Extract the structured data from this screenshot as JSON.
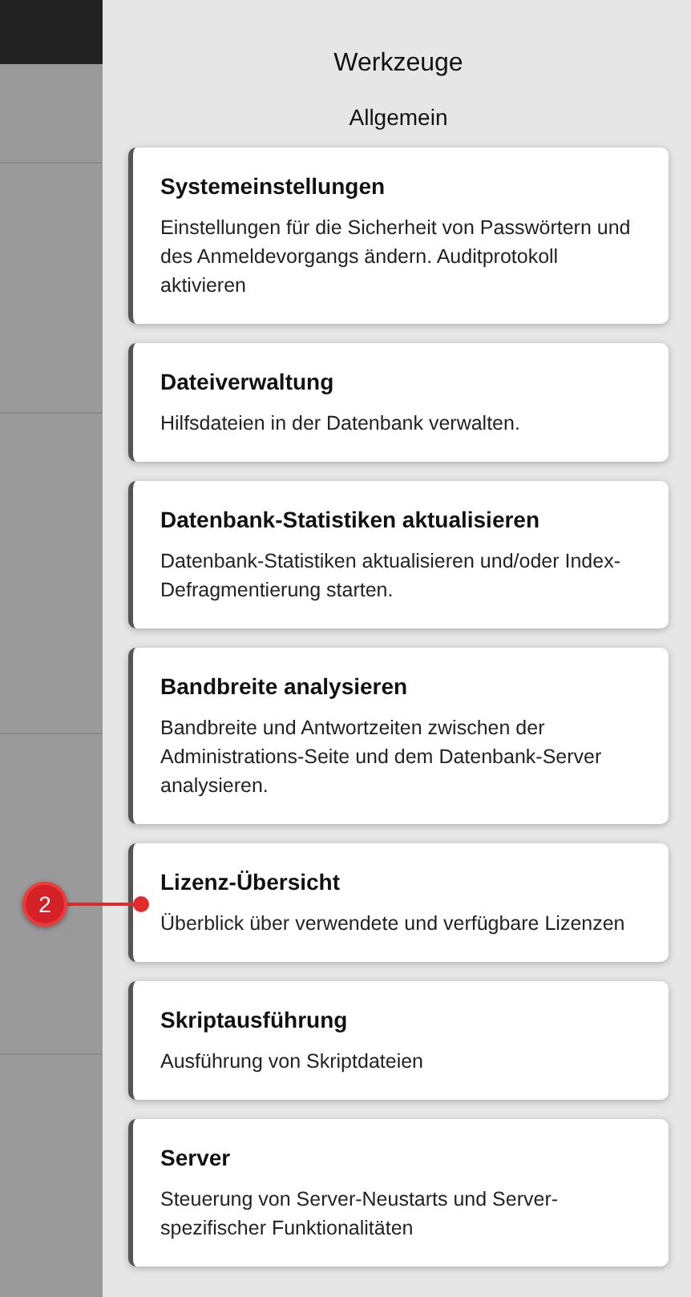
{
  "panel": {
    "title": "Werkzeuge",
    "section": "Allgemein"
  },
  "cards": [
    {
      "title": "Systemeinstellungen",
      "description": "Einstellungen für die Sicherheit von Passwörtern und des Anmeldevorgangs ändern. Auditprotokoll aktivieren"
    },
    {
      "title": "Dateiverwaltung",
      "description": "Hilfsdateien in der Datenbank verwalten."
    },
    {
      "title": "Datenbank-Statistiken aktualisieren",
      "description": "Datenbank-Statistiken aktualisieren und/oder Index-Defragmentierung starten."
    },
    {
      "title": "Bandbreite analysieren",
      "description": "Bandbreite und Antwortzeiten zwischen der Administrations-Seite und dem Datenbank-Server analysieren."
    },
    {
      "title": "Lizenz-Übersicht",
      "description": "Überblick über verwendete und verfügbare Lizenzen",
      "callout": "2"
    },
    {
      "title": "Skriptausführung",
      "description": "Ausführung von Skriptdateien"
    },
    {
      "title": "Server",
      "description": "Steuerung von Server-Neustarts und Server-spezifischer Funktionalitäten"
    }
  ]
}
